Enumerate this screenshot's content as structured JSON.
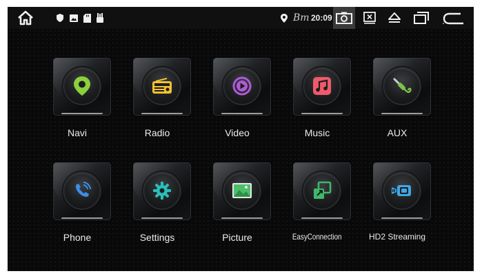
{
  "status_bar": {
    "bt_text": "Bт",
    "time": "20:09",
    "icons": {
      "home": "home-icon",
      "shield": "shield-icon",
      "image": "image-icon",
      "sd_card": "sd-card-icon",
      "usb": "usb-icon",
      "location": "location-icon",
      "screenshot": "screenshot-icon",
      "close_app": "close-window-icon",
      "eject": "eject-icon",
      "recent": "recent-apps-icon",
      "back": "back-icon"
    }
  },
  "apps": [
    {
      "label": "Navi",
      "icon": "navigation-pin-icon",
      "color": "#8bd13b"
    },
    {
      "label": "Radio",
      "icon": "radio-icon",
      "color": "#f2c230"
    },
    {
      "label": "Video",
      "icon": "video-play-icon",
      "color": "#b05ad8"
    },
    {
      "label": "Music",
      "icon": "music-note-icon",
      "color": "#f05a6a"
    },
    {
      "label": "AUX",
      "icon": "aux-cable-icon",
      "color": "#7fc04a"
    },
    {
      "label": "Phone",
      "icon": "phone-icon",
      "color": "#3c8ee8"
    },
    {
      "label": "Settings",
      "icon": "gear-icon",
      "color": "#29c0b8"
    },
    {
      "label": "Picture",
      "icon": "picture-icon",
      "color": "#4dbf6a"
    },
    {
      "label": "EasyConnection",
      "icon": "easy-connection-icon",
      "color": "#3fb86a"
    },
    {
      "label": "HD2 Streaming",
      "icon": "camera-streaming-icon",
      "color": "#3fa8e8"
    }
  ]
}
